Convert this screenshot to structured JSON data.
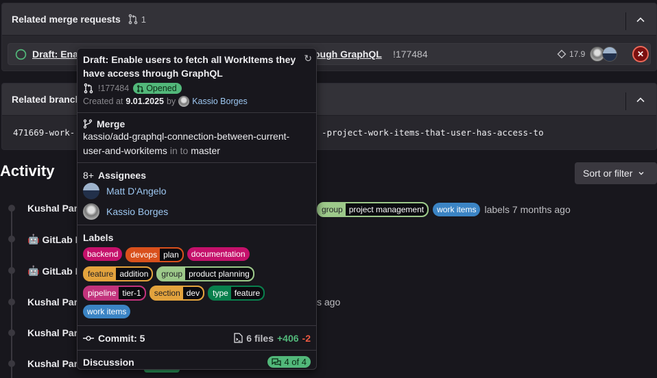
{
  "related_mrs": {
    "title": "Related merge requests",
    "count": "1",
    "item": {
      "title_head": "Draft: Enab",
      "title_tail": "ough GraphQL",
      "ref": "!177484",
      "milestone": "17.9",
      "pipeline_status": "failed"
    }
  },
  "related_branches": {
    "title": "Related branch",
    "branch_head": "471669-work-",
    "branch_tail": "-project-work-items-that-user-has-access-to"
  },
  "activity": {
    "title": "Activity",
    "sort_label": "Sort or filter",
    "items": [
      {
        "author": "Kushal Par",
        "bot": false
      },
      {
        "author": "GitLab B",
        "bot": true
      },
      {
        "author": "GitLab B",
        "bot": true
      },
      {
        "author": "Kushal Par",
        "bot": false
      },
      {
        "author": "Kushal Par",
        "bot": false
      },
      {
        "author": "Kushal Par",
        "bot": false
      }
    ],
    "first_item_labels": [
      {
        "key": "group",
        "value": "project management",
        "color": "#9dc98a"
      },
      {
        "key": "work items",
        "value": null,
        "color": "#3b84c4"
      }
    ],
    "first_item_text": "labels 7 months ago",
    "fourth_item_tail": "s ago"
  },
  "popover": {
    "title": "Draft: Enable users to fetch all WorkItems they have access through GraphQL",
    "ref": "!177484",
    "status": "Opened",
    "created_prefix": "Created at",
    "created_date": "9.01.2025",
    "created_by": "by",
    "author": "Kassio Borges",
    "merge": {
      "heading": "Merge",
      "source": "kassio/add-graphql-connection-between-current-user-and-workitems",
      "into": "in to",
      "target": "master"
    },
    "assignees": {
      "heading": "Assignees",
      "people": [
        "Matt D'Angelo",
        "Kassio Borges"
      ]
    },
    "labels": {
      "heading": "Labels",
      "items": [
        {
          "key": "backend",
          "value": null,
          "color": "#c5116b",
          "text": "#fff"
        },
        {
          "key": "devops",
          "value": "plan",
          "color": "#d9501c",
          "text": "#fff"
        },
        {
          "key": "documentation",
          "value": null,
          "color": "#c5116b",
          "text": "#fff"
        },
        {
          "key": "feature",
          "value": "addition",
          "color": "#e3a33d",
          "text": "#1f1e24"
        },
        {
          "key": "group",
          "value": "product planning",
          "color": "#9dc98a",
          "text": "#1f1e24"
        },
        {
          "key": "pipeline",
          "value": "tier-1",
          "color": "#c2337c",
          "text": "#fff"
        },
        {
          "key": "section",
          "value": "dev",
          "color": "#e3a33d",
          "text": "#1f1e24"
        },
        {
          "key": "type",
          "value": "feature",
          "color": "#09804d",
          "text": "#fff"
        },
        {
          "key": "work items",
          "value": null,
          "color": "#3b84c4",
          "text": "#fff"
        }
      ]
    },
    "commits": "Commit: 5",
    "files": "6 files",
    "additions": "+406",
    "deletions": "-2",
    "discussion": {
      "heading": "Discussion",
      "resolved": "4 of 4"
    }
  }
}
